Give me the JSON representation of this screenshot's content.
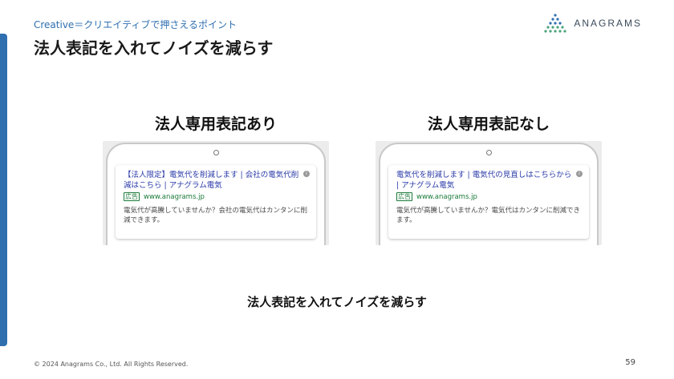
{
  "header": {
    "eyebrow": "Creative＝クリエイティブで押さえるポイント",
    "title": "法人表記を入れてノイズを減らす",
    "logo_text": "ANAGRAMS",
    "accent_color": "#2f6fb0"
  },
  "panels": [
    {
      "heading": "法人専用表記あり",
      "ad": {
        "headline": "【法人限定】電気代を削減します | 会社の電気代削減はこちら | アナグラム電気",
        "badge": "広告",
        "url": "www.anagrams.jp",
        "description": "電気代が高騰していませんか？会社の電気代はカンタンに削減できます。"
      }
    },
    {
      "heading": "法人専用表記なし",
      "ad": {
        "headline": "電気代を削減します | 電気代の見直しはこちらから | アナグラム電気",
        "badge": "広告",
        "url": "www.anagrams.jp",
        "description": "電気代が高騰していませんか？電気代はカンタンに削減できます。"
      }
    }
  ],
  "caption": "法人表記を入れてノイズを減らす",
  "footer": {
    "copyright": "© 2024 Anagrams Co., Ltd. All Rights Reserved.",
    "page_number": "59"
  }
}
